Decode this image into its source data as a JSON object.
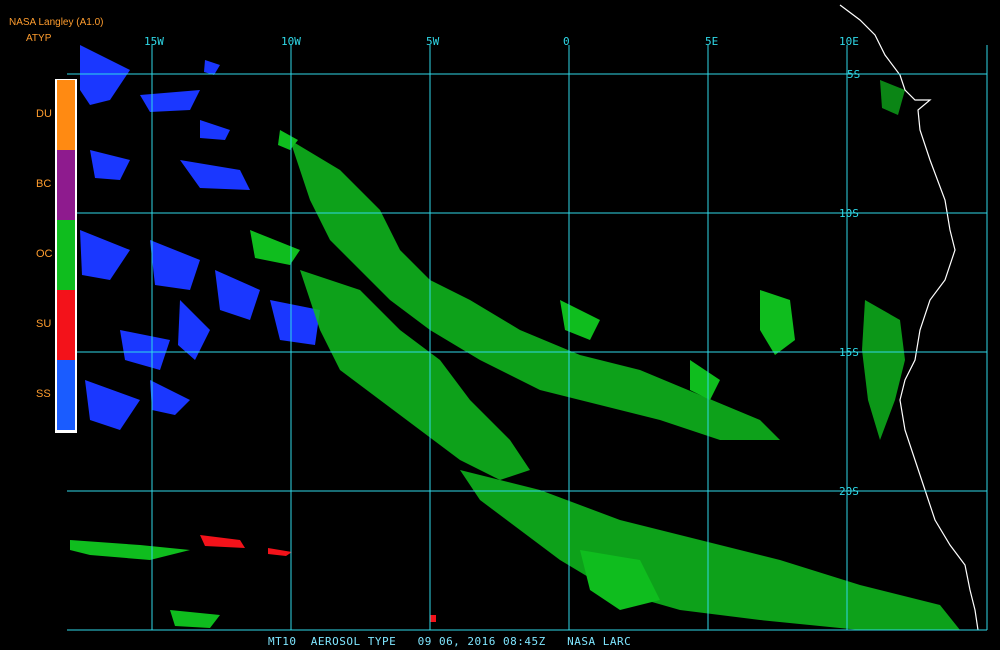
{
  "header": {
    "org": "NASA Langley (A1.0)",
    "product": "ATYP"
  },
  "legend": [
    {
      "label": "DU",
      "color": "#ff8a12"
    },
    {
      "label": "BC",
      "color": "#8e1b8e"
    },
    {
      "label": "OC",
      "color": "#0fbd1e"
    },
    {
      "label": "SU",
      "color": "#f3121a"
    },
    {
      "label": "SS",
      "color": "#1a5cff"
    }
  ],
  "longitude_labels": [
    "15W",
    "10W",
    "5W",
    "0",
    "5E",
    "10E"
  ],
  "latitude_labels": [
    "5S",
    "10S",
    "15S",
    "20S"
  ],
  "footer": "MT10  AEROSOL TYPE   09 06, 2016 08:45Z   NASA LARC",
  "colors": {
    "grid": "#2fd9e8",
    "coast": "#ffffff",
    "label": "#ff9d2e"
  }
}
